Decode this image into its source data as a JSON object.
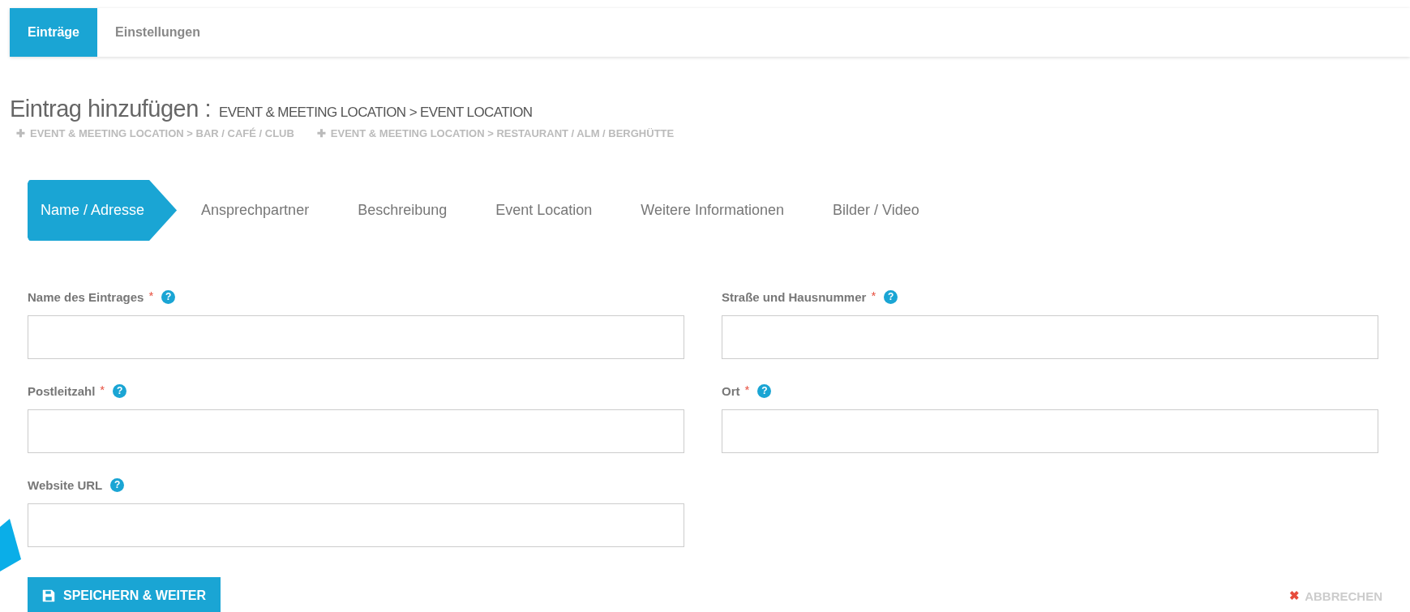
{
  "tabs": [
    {
      "label": "Einträge",
      "selected": true
    },
    {
      "label": "Einstellungen",
      "selected": false
    }
  ],
  "heading": {
    "title": "Eintrag hinzufügen :",
    "category": "EVENT & MEETING LOCATION > EVENT LOCATION"
  },
  "other_categories": [
    {
      "icon": "✚",
      "label": "EVENT & MEETING LOCATION > BAR / CAFÉ / CLUB"
    },
    {
      "icon": "✚",
      "label": "EVENT & MEETING LOCATION > RESTAURANT / ALM / BERGHÜTTE"
    }
  ],
  "steps": [
    {
      "label": "Name / Adresse",
      "selected": true
    },
    {
      "label": "Ansprechpartner",
      "selected": false
    },
    {
      "label": "Beschreibung",
      "selected": false
    },
    {
      "label": "Event Location",
      "selected": false
    },
    {
      "label": "Weitere Informationen",
      "selected": false
    },
    {
      "label": "Bilder / Video",
      "selected": false
    }
  ],
  "fields": [
    {
      "label": "Name des Eintrages",
      "required": true,
      "required_mark": "*"
    },
    {
      "label": "Straße und Hausnummer",
      "required": true,
      "required_mark": "*"
    },
    {
      "label": "Postleitzahl",
      "required": true,
      "required_mark": "*"
    },
    {
      "label": "Ort",
      "required": true,
      "required_mark": "*"
    },
    {
      "label": "Website URL",
      "required": false
    }
  ],
  "help_glyph": "?",
  "save_button": {
    "label": "SPEICHERN & WEITER"
  },
  "cancel_button": {
    "icon": "✖",
    "label": "ABBRECHEN"
  }
}
